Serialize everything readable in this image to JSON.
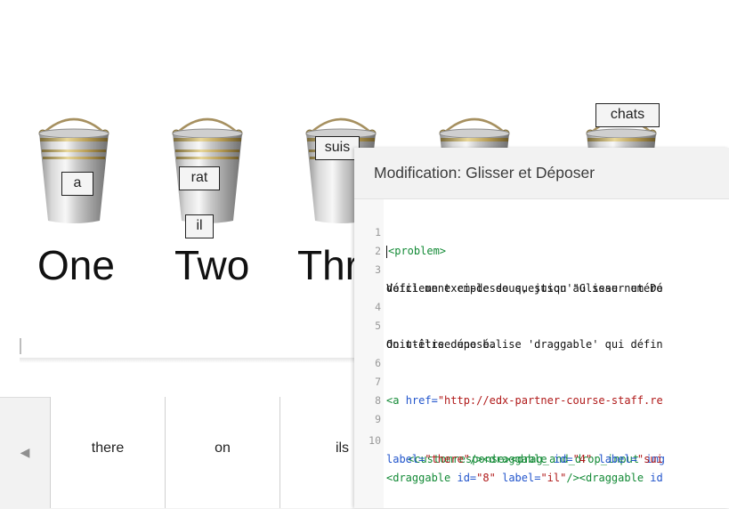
{
  "canvas": {
    "numbers": [
      "One",
      "Two",
      "Thr"
    ],
    "placed_labels": {
      "a": "a",
      "rat": "rat",
      "il": "il",
      "suis": "suis",
      "chats": "chats"
    }
  },
  "tray": {
    "prev_arrow": "◀",
    "items": [
      "there",
      "on",
      "ils"
    ]
  },
  "modal": {
    "title": "Modification: Glisser et Déposer"
  },
  "editor": {
    "line_numbers": [
      "1",
      "2",
      "3",
      "4",
      "5",
      "6",
      "7",
      "8",
      "9",
      "10"
    ],
    "l1": "problem>",
    "l1_open": "<",
    "l3a": "Voici un exemple de question \"Glisser et Dé",
    "l3b": "défilement ci-dessous, jusqu'au seau numéro",
    "l5a": "On utilise une balise 'draggable' qui défin",
    "l5b": "doit-être déposé.",
    "l7": {
      "open": "<a",
      "attr": "href=",
      "value": "\"http://edx-partner-course-staff.re"
    },
    "l10": {
      "tag": "<customresponse><drag_and_drop_input",
      "attr": "img"
    },
    "l10b": {
      "attr1": "label=",
      "val1": "\"there\"",
      "tag1": "/><draggable",
      "attr2": "id=",
      "val2": "\"4\"",
      "attr3": "label=",
      "val3": "\"sui"
    },
    "l10c": {
      "tag1": "<draggable",
      "attr1": "id=",
      "val1": "\"8\"",
      "attr2": "label=",
      "val2": "\"il\"",
      "tag2": "/><draggable",
      "attr3": "id"
    }
  }
}
